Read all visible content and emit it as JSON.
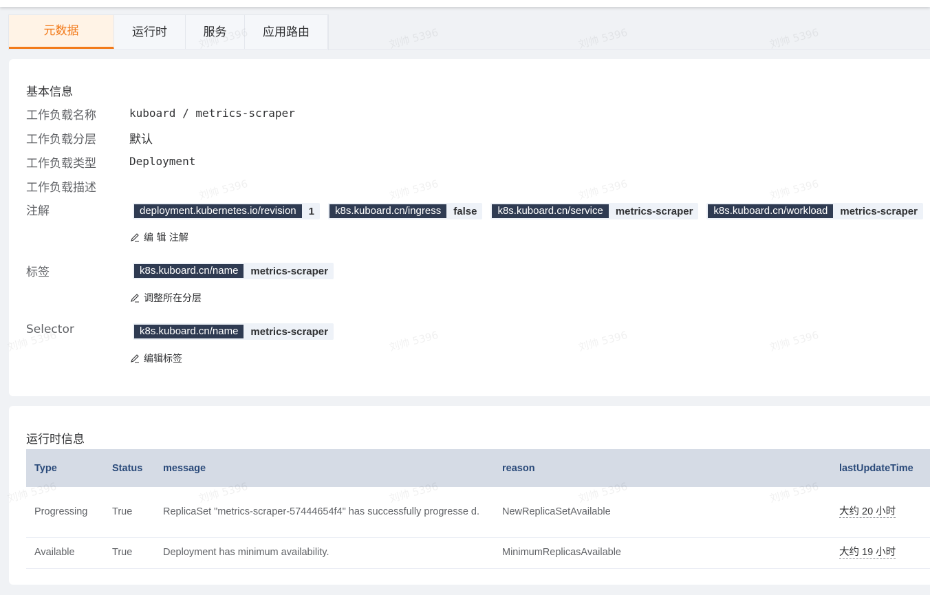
{
  "tabs": [
    {
      "label": "元数据",
      "active": true
    },
    {
      "label": "运行时",
      "active": false
    },
    {
      "label": "服务",
      "active": false
    },
    {
      "label": "应用路由",
      "active": false
    }
  ],
  "basic": {
    "title": "基本信息",
    "rows": [
      {
        "label": "工作负载名称",
        "value": "kuboard / metrics-scraper"
      },
      {
        "label": "工作负载分层",
        "value": "默认"
      },
      {
        "label": "工作负载类型",
        "value": "Deployment"
      },
      {
        "label": "工作负载描述",
        "value": ""
      }
    ],
    "annotations_label": "注解",
    "annotations": [
      {
        "key": "deployment.kubernetes.io/revision",
        "value": "1"
      },
      {
        "key": "k8s.kuboard.cn/ingress",
        "value": "false"
      },
      {
        "key": "k8s.kuboard.cn/service",
        "value": "metrics-scraper"
      },
      {
        "key": "k8s.kuboard.cn/workload",
        "value": "metrics-scraper"
      }
    ],
    "edit_annotations": "编 辑 注解",
    "labels_label": "标签",
    "labels": [
      {
        "key": "k8s.kuboard.cn/name",
        "value": "metrics-scraper"
      }
    ],
    "adjust_layer": "调整所在分层",
    "selector_label": "Selector",
    "selector": [
      {
        "key": "k8s.kuboard.cn/name",
        "value": "metrics-scraper"
      }
    ],
    "edit_labels": "编辑标签"
  },
  "runtime": {
    "title": "运行时信息",
    "columns": [
      "Type",
      "Status",
      "message",
      "reason",
      "lastUpdateTime"
    ],
    "rows": [
      {
        "type": "Progressing",
        "status": "True",
        "message": "ReplicaSet \"metrics-scraper-57444654f4\" has successfully progresse d.",
        "reason": "NewReplicaSetAvailable",
        "time": "大约 20 小时"
      },
      {
        "type": "Available",
        "status": "True",
        "message": "Deployment has minimum availability.",
        "reason": "MinimumReplicasAvailable",
        "time": "大约 19 小时"
      }
    ]
  },
  "watermark": "刘帅 5396",
  "colors": {
    "accent": "#f27a1a",
    "tag_key_bg": "#2f3b52",
    "table_header_bg": "#d5dbe5"
  }
}
